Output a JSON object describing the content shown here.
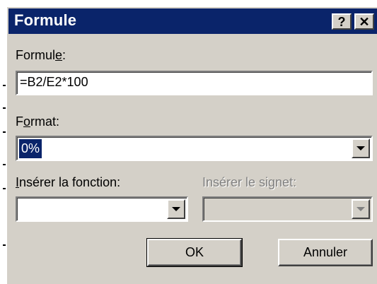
{
  "dialog": {
    "title": "Formule",
    "help_label": "?",
    "close_label": "✕"
  },
  "formula": {
    "label_pre": "Formul",
    "label_accel": "e",
    "label_post": ":",
    "value": "=B2/E2*100"
  },
  "format": {
    "label_pre": "F",
    "label_accel": "o",
    "label_post": "rmat:",
    "value": "0%"
  },
  "insert_function": {
    "label_accel": "I",
    "label_post": "nsérer la fonction:",
    "value": ""
  },
  "insert_bookmark": {
    "label": "Insérer le signet:",
    "value": "",
    "disabled": true
  },
  "buttons": {
    "ok": "OK",
    "cancel": "Annuler"
  }
}
